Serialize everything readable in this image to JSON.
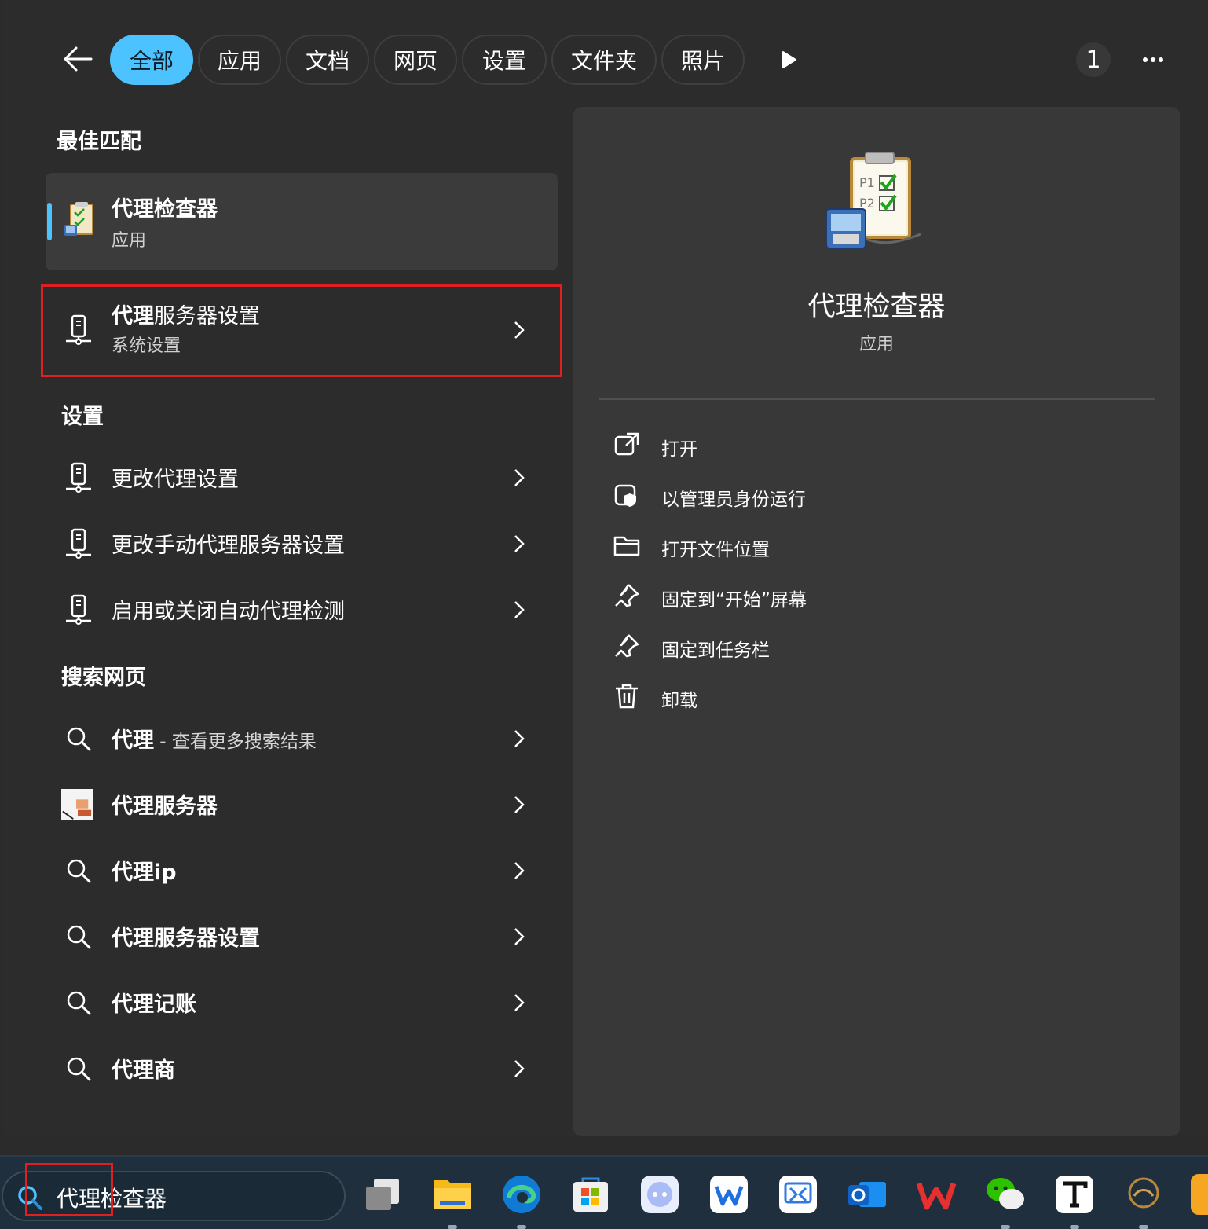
{
  "filters": {
    "tabs": [
      {
        "label": "全部",
        "active": true
      },
      {
        "label": "应用"
      },
      {
        "label": "文档"
      },
      {
        "label": "网页"
      },
      {
        "label": "设置"
      },
      {
        "label": "文件夹"
      },
      {
        "label": "照片"
      }
    ],
    "badge": "1"
  },
  "best_match": {
    "section_title": "最佳匹配",
    "title": "代理检查器",
    "subtitle": "应用"
  },
  "highlight_item": {
    "title_bold": "代理",
    "title_rest": "服务器设置",
    "subtitle": "系统设置"
  },
  "settings": {
    "section_title": "设置",
    "items": [
      {
        "label": "更改代理设置"
      },
      {
        "label": "更改手动代理服务器设置"
      },
      {
        "label": "启用或关闭自动代理检测"
      }
    ]
  },
  "web": {
    "section_title": "搜索网页",
    "items": [
      {
        "bold": "代理",
        "rest": " - ",
        "sub": "查看更多搜索结果"
      },
      {
        "bold": "代理服务器",
        "rest": "",
        "sub": ""
      },
      {
        "bold": "代理ip",
        "rest": "",
        "sub": ""
      },
      {
        "bold": "代理服务器设置",
        "rest": "",
        "sub": ""
      },
      {
        "bold": "代理记账",
        "rest": "",
        "sub": ""
      },
      {
        "bold": "代理商",
        "rest": "",
        "sub": ""
      }
    ]
  },
  "detail": {
    "name": "代理检查器",
    "type": "应用",
    "actions": [
      {
        "label": "打开",
        "icon": "open-external-icon"
      },
      {
        "label": "以管理员身份运行",
        "icon": "shield-admin-icon"
      },
      {
        "label": "打开文件位置",
        "icon": "folder-icon"
      },
      {
        "label": "固定到“开始”屏幕",
        "icon": "pin-icon"
      },
      {
        "label": "固定到任务栏",
        "icon": "pin-icon"
      },
      {
        "label": "卸载",
        "icon": "trash-icon"
      }
    ]
  },
  "taskbar": {
    "search_value": "代理检查器"
  },
  "colors": {
    "accent": "#4cc2ff",
    "highlight": "#e02020"
  }
}
